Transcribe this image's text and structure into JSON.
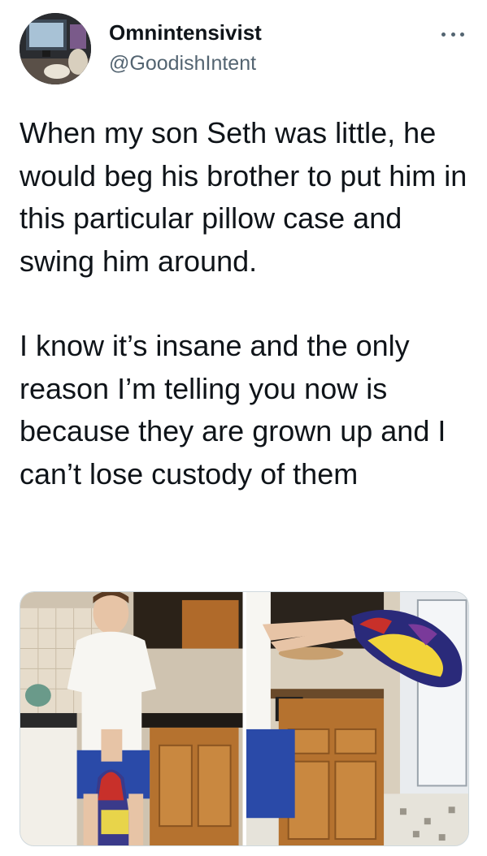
{
  "tweet": {
    "author": {
      "display_name": "Omnintensivist",
      "handle": "@GoodishIntent",
      "avatar_icon": "profile-photo"
    },
    "more_icon": "more-horizontal-icon",
    "paragraphs": [
      "When my son Seth was little, he would beg his brother to put him in this particular pillow case and swing him around.",
      "I know it’s insane and the only reason I’m telling you now is because they are grown up and I can’t lose custody of them"
    ],
    "media": [
      {
        "kind": "photo",
        "subject": "boy-in-pillowcase"
      },
      {
        "kind": "photo",
        "subject": "swinging-pillowcase"
      }
    ]
  },
  "colors": {
    "text_primary": "#0f1419",
    "text_secondary": "#536471",
    "border": "#cfd9de",
    "background": "#ffffff"
  }
}
